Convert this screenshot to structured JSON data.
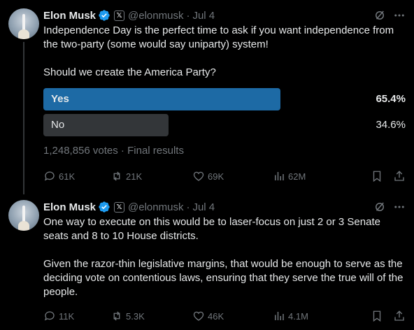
{
  "tweets": [
    {
      "author": {
        "name": "Elon Musk",
        "handle": "@elonmusk",
        "date": "Jul 4",
        "separator": "·"
      },
      "text": "Independence Day is the perfect time to ask if you want independence from the two-party (some would say uniparty) system!\n\nShould we create the America Party?",
      "poll": {
        "options": [
          {
            "label": "Yes",
            "percent_text": "65.4%",
            "percent": 65.4,
            "winner": true
          },
          {
            "label": "No",
            "percent_text": "34.6%",
            "percent": 34.6,
            "winner": false
          }
        ],
        "votes": "1,248,856 votes",
        "status": "Final results",
        "meta_separator": " · "
      },
      "actions": {
        "replies": "61K",
        "reposts": "21K",
        "likes": "69K",
        "views": "62M"
      }
    },
    {
      "author": {
        "name": "Elon Musk",
        "handle": "@elonmusk",
        "date": "Jul 4",
        "separator": "·"
      },
      "text": "One way to execute on this would be to laser-focus on just 2 or 3 Senate seats and 8 to 10 House districts.\n\nGiven the razor-thin legislative margins, that would be enough to serve as the deciding vote on contentious laws, ensuring that they serve the true will of the people.",
      "actions": {
        "replies": "11K",
        "reposts": "5.3K",
        "likes": "46K",
        "views": "4.1M"
      }
    }
  ],
  "colors": {
    "accent": "#1d9bf0",
    "poll_winner": "#1d6aa5",
    "poll_other": "#333639",
    "muted": "#71767b",
    "text": "#e7e9ea",
    "background": "#000000"
  },
  "icons": [
    "verified-badge-icon",
    "x-badge-icon",
    "grok-icon",
    "more-icon",
    "reply-icon",
    "repost-icon",
    "like-icon",
    "views-icon",
    "bookmark-icon",
    "share-icon"
  ]
}
